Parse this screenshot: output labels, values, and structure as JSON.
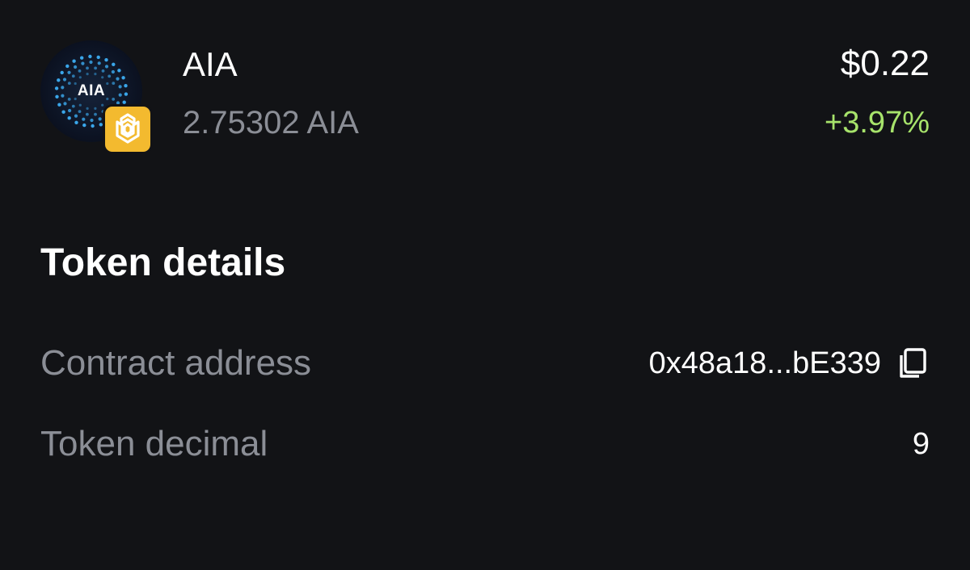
{
  "token": {
    "avatar_label": "AIA",
    "avatar_icon": "aia-logo-icon",
    "chain_icon": "bnb-chain-icon",
    "name": "AIA",
    "balance": "2.75302 AIA",
    "price": "$0.22",
    "change": "+3.97%",
    "change_color": "#a7e36b"
  },
  "details": {
    "title": "Token details",
    "rows": [
      {
        "label": "Contract address",
        "value": "0x48a18...bE339",
        "icon": "copy-icon"
      },
      {
        "label": "Token decimal",
        "value": "9"
      }
    ]
  },
  "colors": {
    "background": "#121316",
    "primary_text": "#ffffff",
    "secondary_text": "#8b8e96",
    "positive": "#a7e36b",
    "bnb_yellow": "#f3ba2f",
    "avatar_dot": "#3fb6ff"
  }
}
